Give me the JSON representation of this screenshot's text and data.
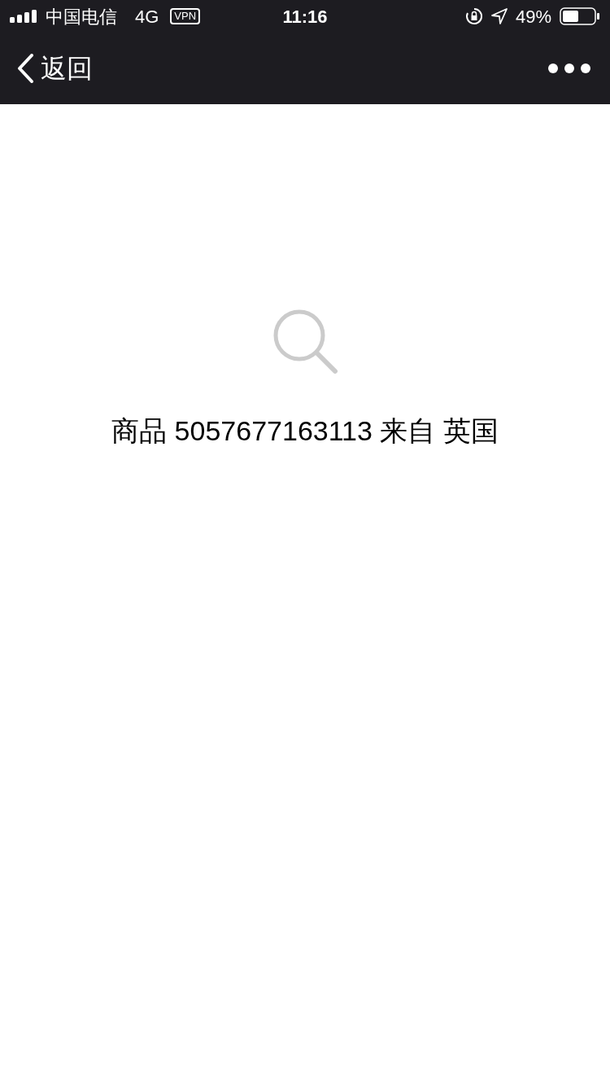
{
  "status_bar": {
    "carrier": "中国电信",
    "network": "4G",
    "vpn": "VPN",
    "time": "11:16",
    "battery": "49%"
  },
  "nav_bar": {
    "back": "返回"
  },
  "message": "商品 5057677163113 来自 英国"
}
